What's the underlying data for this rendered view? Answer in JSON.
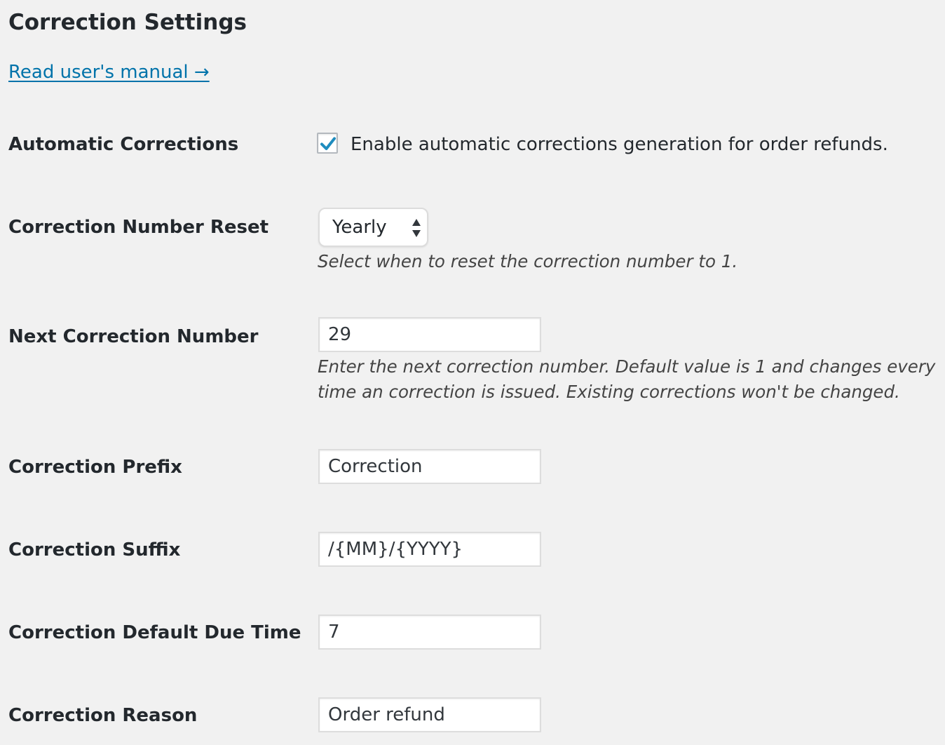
{
  "page": {
    "title": "Correction Settings",
    "manual_link": "Read user's manual →"
  },
  "colors": {
    "background": "#f1f1f1",
    "link": "#0073aa",
    "checkmark": "#1e8cbe",
    "text": "#23282d"
  },
  "fields": {
    "automatic_corrections": {
      "label": "Automatic Corrections",
      "checkbox_label": "Enable automatic corrections generation for order refunds.",
      "checked": true,
      "icon": "checkmark-icon"
    },
    "number_reset": {
      "label": "Correction Number Reset",
      "selected": "Yearly",
      "icon": "select-arrows-icon",
      "description": "Select when to reset the correction number to 1."
    },
    "next_number": {
      "label": "Next Correction Number",
      "value": "29",
      "description_line1": "Enter the next correction number. Default value is 1 and changes every",
      "description_line2": "time an correction is issued. Existing corrections won't be changed."
    },
    "prefix": {
      "label": "Correction Prefix",
      "value": "Correction"
    },
    "suffix": {
      "label": "Correction Suffix",
      "value": "/{MM}/{YYYY}"
    },
    "due_time": {
      "label": "Correction Default Due Time",
      "value": "7"
    },
    "reason": {
      "label": "Correction Reason",
      "value": "Order refund"
    }
  }
}
